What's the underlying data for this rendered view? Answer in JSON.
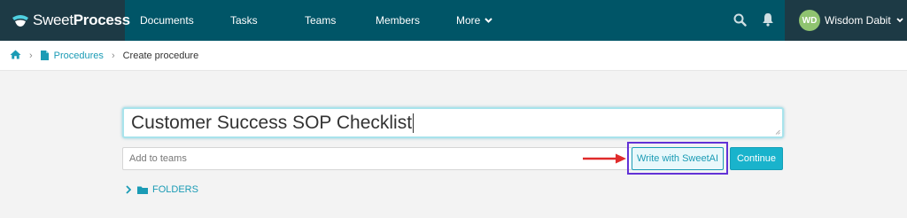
{
  "app": {
    "logo": {
      "part1": "Sweet",
      "part2": "Process"
    }
  },
  "nav": {
    "items": [
      {
        "label": "Documents"
      },
      {
        "label": "Tasks"
      },
      {
        "label": "Teams"
      },
      {
        "label": "Members"
      },
      {
        "label": "More"
      }
    ],
    "icons": [
      "search-icon",
      "bell-icon",
      "chevron-down-icon"
    ]
  },
  "user": {
    "initials": "WD",
    "name": "Wisdom Dabit",
    "avatar_color": "#8fc370"
  },
  "breadcrumb": {
    "home_icon": "home-icon",
    "link_label": "Procedures",
    "current": "Create procedure"
  },
  "form": {
    "title_value": "Customer Success SOP Checklist",
    "teams_placeholder": "Add to teams",
    "sweetai_label": "Write with SweetAI",
    "continue_label": "Continue"
  },
  "folders": {
    "label": "FOLDERS"
  },
  "colors": {
    "nav_bg": "#005567",
    "logo_bg": "#1d3a45",
    "accent": "#1a9bb5",
    "continue_bg": "#19b3cc",
    "annotation_arrow": "#e02b2b",
    "annotation_box": "#6232d6"
  }
}
